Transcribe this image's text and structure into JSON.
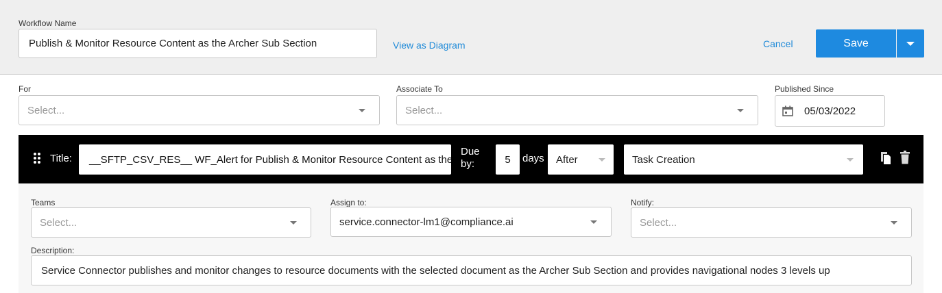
{
  "header": {
    "workflow_name_label": "Workflow Name",
    "workflow_name_value": "Publish & Monitor Resource Content as the Archer Sub Section",
    "view_diagram_link": "View as Diagram",
    "cancel_link": "Cancel",
    "save_button": "Save"
  },
  "filters": {
    "for_label": "For",
    "for_placeholder": "Select...",
    "associate_label": "Associate To",
    "associate_placeholder": "Select...",
    "published_label": "Published Since",
    "published_value": "05/03/2022"
  },
  "task": {
    "title_label": "Title:",
    "title_value": "__SFTP_CSV_RES__ WF_Alert for Publish & Monitor Resource Content as the",
    "due_label_1": "Due",
    "due_label_2": "by:",
    "due_value": "5",
    "days_label": "days",
    "after_value": "After",
    "trigger_value": "Task Creation"
  },
  "details": {
    "teams_label": "Teams",
    "teams_placeholder": "Select...",
    "assign_label": "Assign to:",
    "assign_value": "service.connector-lm1@compliance.ai",
    "notify_label": "Notify:",
    "notify_placeholder": "Select...",
    "description_label": "Description:",
    "description_value": "Service Connector publishes and monitor changes to resource documents with the selected document as the Archer Sub Section and provides navigational nodes 3 levels up"
  }
}
